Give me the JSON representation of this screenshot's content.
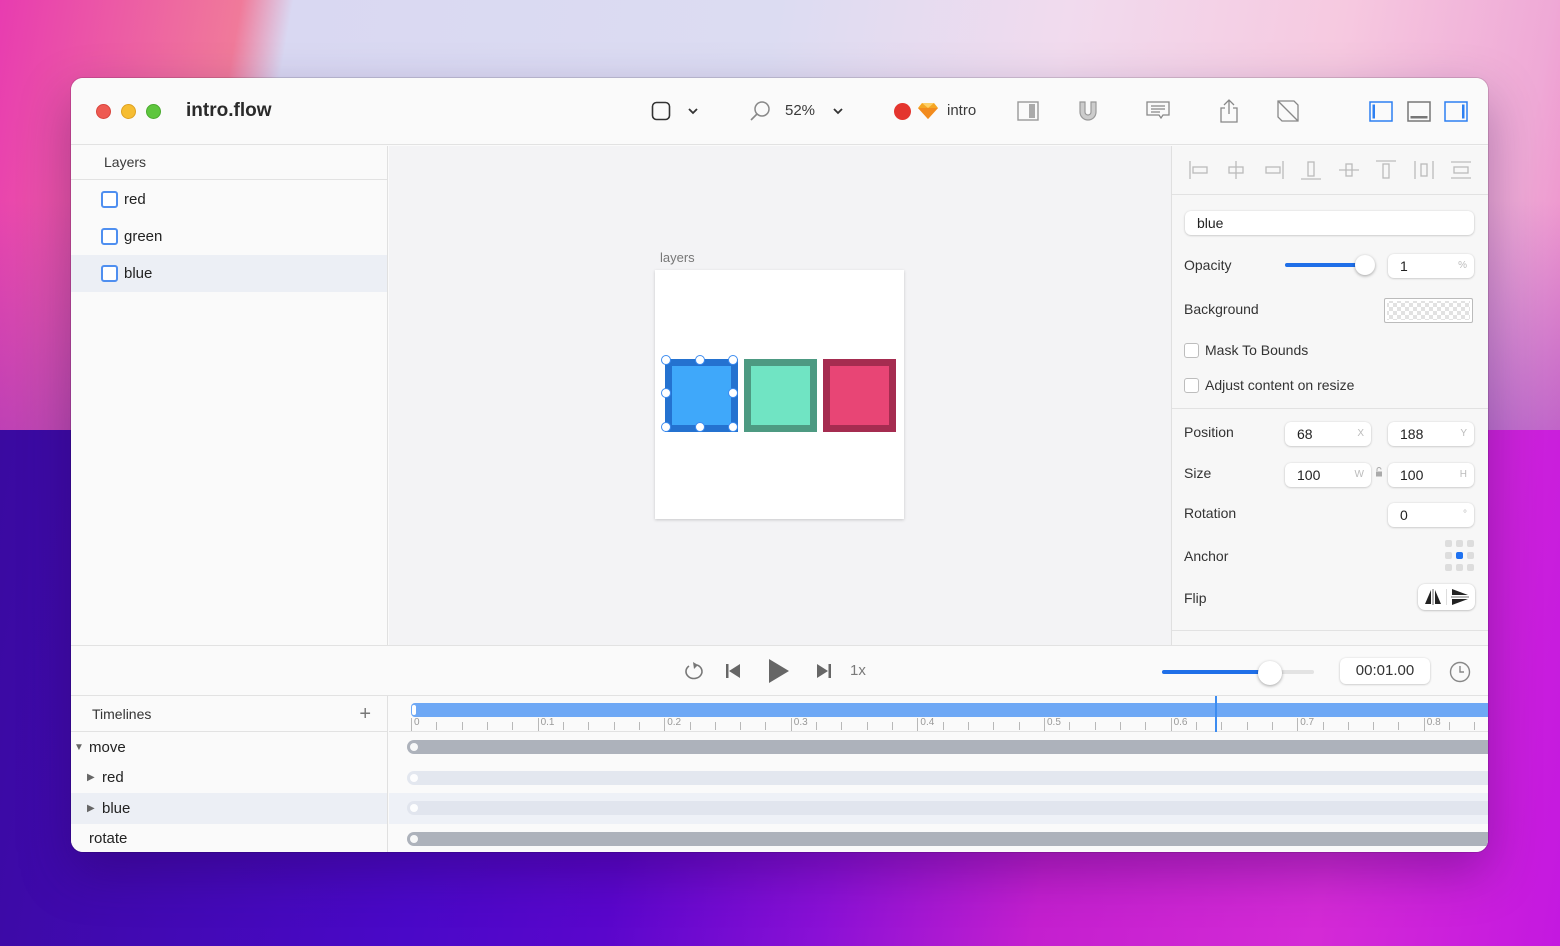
{
  "window": {
    "title": "intro.flow"
  },
  "toolbar": {
    "shape_tool_icon": "square-icon",
    "zoom_level": "52%",
    "scene_color": "#e4352e",
    "scene_name": "intro",
    "icons": [
      "square-icon",
      "chevron-down-icon",
      "search-icon",
      "chevron-down-icon",
      "sketch-icon",
      "sidebar-toggle-icon",
      "magnet-icon",
      "comment-icon",
      "share-icon",
      "no-preview-icon",
      "left-panel-icon",
      "bottom-panel-icon",
      "right-panel-icon"
    ]
  },
  "layers": {
    "header": "Layers",
    "items": [
      {
        "label": "red",
        "selected": false
      },
      {
        "label": "green",
        "selected": false
      },
      {
        "label": "blue",
        "selected": true
      }
    ]
  },
  "canvas": {
    "artboard_label": "layers",
    "shapes": [
      {
        "name": "blue",
        "fill": "#3fa8fa",
        "stroke": "#2472d0",
        "selected": true
      },
      {
        "name": "green",
        "fill": "#70e4c3",
        "stroke": "#4d9a82",
        "selected": false
      },
      {
        "name": "red",
        "fill": "#e84575",
        "stroke": "#a52c50",
        "selected": false
      }
    ]
  },
  "inspector": {
    "align_icons": [
      "align-left-icon",
      "align-center-h-icon",
      "align-right-icon",
      "align-bottom-icon",
      "align-center-v-icon",
      "align-top-icon",
      "distribute-h-icon",
      "distribute-v-icon"
    ],
    "name_value": "blue",
    "opacity_label": "Opacity",
    "opacity_value": "1",
    "opacity_unit": "%",
    "opacity_fraction": 1.0,
    "background_label": "Background",
    "mask_label": "Mask To Bounds",
    "mask_checked": false,
    "adjust_label": "Adjust content on resize",
    "adjust_checked": false,
    "position_label": "Position",
    "position_x": "68",
    "position_x_unit": "X",
    "position_y": "188",
    "position_y_unit": "Y",
    "size_label": "Size",
    "size_w": "100",
    "size_w_unit": "W",
    "size_h": "100",
    "size_h_unit": "H",
    "rotation_label": "Rotation",
    "rotation_value": "0",
    "rotation_unit": "°",
    "anchor_label": "Anchor",
    "anchor_selected": "center",
    "flip_label": "Flip"
  },
  "playback": {
    "speed": "1x",
    "scrubber_fraction": 0.75,
    "time": "00:01.00"
  },
  "timelines": {
    "header": "Timelines",
    "add_label": "+",
    "rows": [
      {
        "label": "move",
        "expander": "expanded",
        "indent": 0,
        "selected": false
      },
      {
        "label": "red",
        "expander": "collapsed",
        "indent": 1,
        "selected": false
      },
      {
        "label": "blue",
        "expander": "collapsed",
        "indent": 1,
        "selected": true
      },
      {
        "label": "rotate",
        "expander": "none",
        "indent": 0,
        "selected": false
      }
    ],
    "ruler_labels": [
      "0",
      "0.1",
      "0.2",
      "0.3",
      "0.4",
      "0.5",
      "0.6",
      "0.7",
      "0.8"
    ],
    "playhead_time": 0.635
  }
}
